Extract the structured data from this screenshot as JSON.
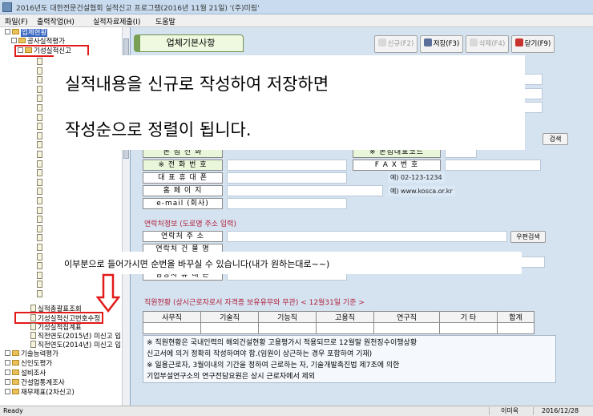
{
  "window": {
    "title": "2016년도 대한전문건설협회 실적신고 프로그램(2016년 11월 21일)    '(주)미림'"
  },
  "menu": [
    "파일(F)",
    "출력작업(H)",
    "실적자료제출(I)",
    "도움말"
  ],
  "tree": {
    "root": "업체현황",
    "group1": "공사실적평가",
    "group1_child": "기성실적신고",
    "items_after": [
      "실적총괄표조회",
      "기성실적신고번호수정",
      "기성실적집계표",
      "직전연도(2015년) 미신고 입",
      "직전연도(2014년) 미신고 입"
    ],
    "groups_bottom": [
      "기술능력평가",
      "신인도평가",
      "설비조사",
      "건설업통계조사",
      "재무제표(2차신고)"
    ]
  },
  "toolbar": {
    "tab": "업체기본사항",
    "new": "신규(F2)",
    "save": "저장(F3)",
    "delete": "삭제(F4)",
    "close": "닫기(F9)"
  },
  "overlay": {
    "line1": "실적내용을 신규로 작성하여 저장하면",
    "line2": "작성순으로 정렬이 됩니다."
  },
  "form": {
    "search_button": "검색",
    "row0_label": "본 점 전 화",
    "row0_label_right": "※ 본점대표코드",
    "phone_label": "※ 전 화 번 호",
    "fax_label": "F A X 번 호",
    "ceo_mobile_label": "대 표 휴 대 폰",
    "phone_example": "예) 02-123-1234",
    "homepage_label": "홈 페 이 지",
    "homepage_example": "예) www.kosca.or.kr",
    "email_label": "e-mail (회사)",
    "contact_section": "연락처정보 (도로명 주소 입력)",
    "contact_addr_label": "연락처 주 소",
    "zip_button": "우편검색",
    "contact_building_label": "연락처 건 물 명",
    "manager_mobile_label": "담당자 휴 대 폰"
  },
  "callout": {
    "text": "이부분으로 들어가시면 순번을 바꾸실 수 있습니다(내가 원하는대로~~)"
  },
  "staff": {
    "title": "직원현황 (상시근로자로서 자격증 보유유무와 무관) < 12월31일 기준 >",
    "columns": [
      "사무직",
      "기술직",
      "기능직",
      "고용직",
      "연구직",
      "기 타",
      "합계"
    ],
    "notes": [
      "※ 직원현황은 국내인력의 해외건설현황 고용평가시 적용되므로 12월말 원천징수이행상황",
      "   신고서에 의거 정확히 작성하여야 함.(임원이 상근하는 경우 포함하여 기재)",
      "※ 일용근로자, 3월이내의 기간을 정하여 근로하는 자, 기술개발촉진법 제7조에 의한",
      "   기업부설연구소의 연구전담요원은 상시 근로자에서 제외"
    ]
  },
  "status": {
    "left": "Ready",
    "user": "이미옥",
    "date": "2016/12/28"
  }
}
